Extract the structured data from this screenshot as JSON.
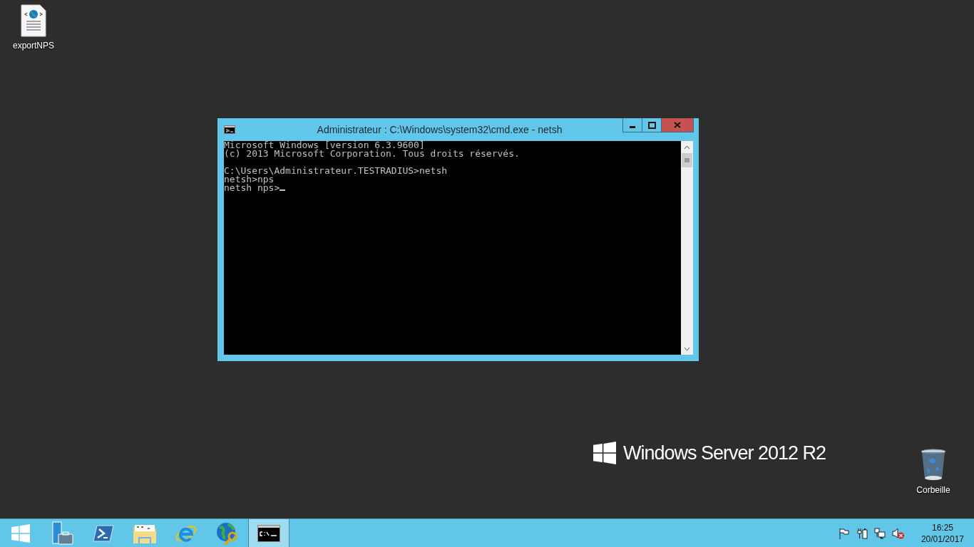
{
  "desktop_icons": [
    {
      "kind": "document",
      "label": "exportNPS"
    },
    {
      "kind": "recycle",
      "label": "Corbeille"
    }
  ],
  "branding": "Windows Server 2012 R2",
  "window": {
    "title": "Administrateur : C:\\Windows\\system32\\cmd.exe - netsh",
    "console": {
      "blocks": [
        [
          "Microsoft Windows [version 6.3.9600]",
          "(c) 2013 Microsoft Corporation. Tous droits réservés."
        ],
        [
          "C:\\Users\\Administrateur.TESTRADIUS>netsh",
          "netsh>nps",
          "netsh nps>"
        ]
      ],
      "cursor": true
    }
  },
  "taskbar": {
    "items": [
      {
        "kind": "start",
        "selected": false
      },
      {
        "kind": "server-manager",
        "selected": false
      },
      {
        "kind": "powershell",
        "selected": false
      },
      {
        "kind": "explorer",
        "selected": false
      },
      {
        "kind": "browser",
        "selected": false
      },
      {
        "kind": "globe-key",
        "selected": false
      },
      {
        "kind": "console",
        "selected": true
      }
    ],
    "tray": [
      {
        "kind": "flag"
      },
      {
        "kind": "power"
      },
      {
        "kind": "network"
      },
      {
        "kind": "speaker-muted"
      }
    ],
    "time": "16:25",
    "date": "20/01/2017"
  }
}
